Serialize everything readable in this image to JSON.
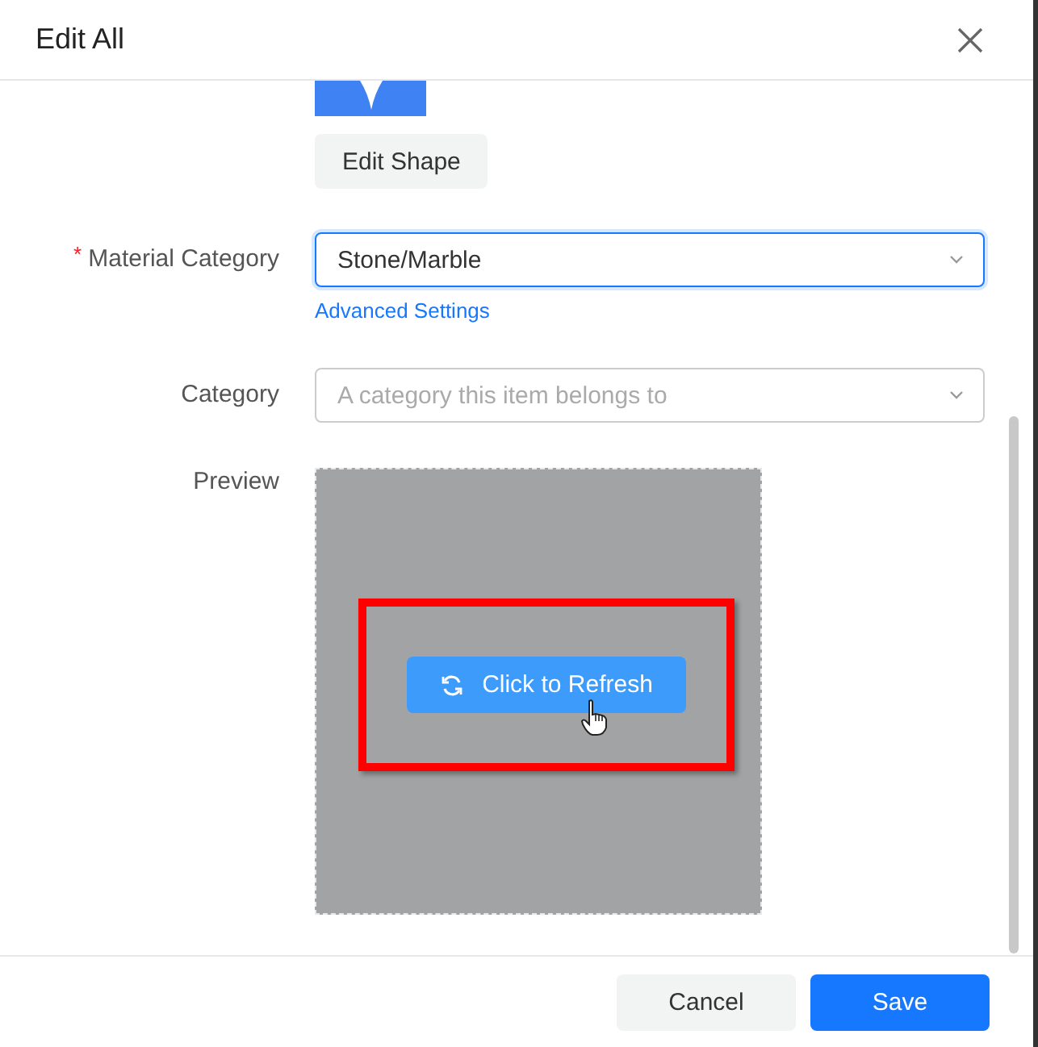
{
  "dialog": {
    "title": "Edit All"
  },
  "required_mark": "*",
  "shape": {
    "kind": "picture",
    "button": "Edit Shape"
  },
  "fields": [
    {
      "label": "Material Category",
      "required": true,
      "focused": true,
      "value": "Stone/Marble",
      "link": "Advanced Settings"
    },
    {
      "label": "Category",
      "required": false,
      "focused": false,
      "placeholder": "A category this item belongs to"
    }
  ],
  "preview": {
    "label": "Preview",
    "button": "Click to Refresh",
    "highlighted": true
  },
  "footer": {
    "buttons": [
      {
        "label": "Cancel",
        "kind": "default"
      },
      {
        "label": "Save",
        "kind": "primary"
      }
    ]
  }
}
